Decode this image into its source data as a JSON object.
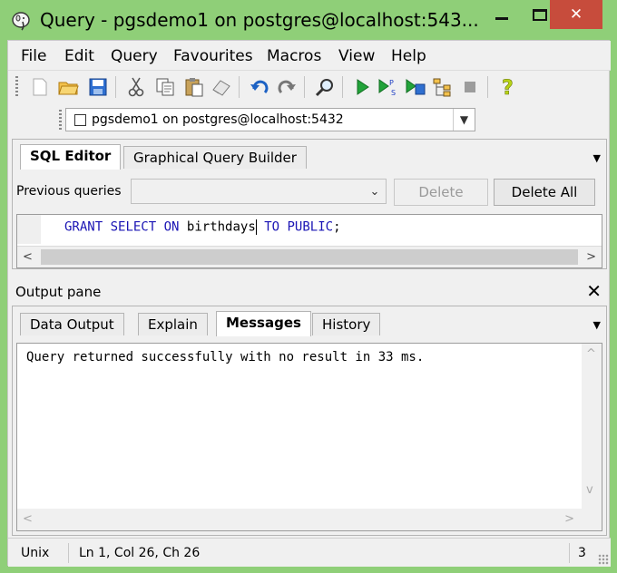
{
  "window": {
    "title": "Query - pgsdemo1 on postgres@localhost:543...",
    "close_glyph": "✕"
  },
  "menu": {
    "items": [
      "File",
      "Edit",
      "Query",
      "Favourites",
      "Macros",
      "View",
      "Help"
    ]
  },
  "toolbar": {
    "icons": [
      "new-icon",
      "open-icon",
      "save-icon",
      "cut-icon",
      "copy-icon",
      "paste-icon",
      "clear-icon",
      "undo-icon",
      "redo-icon",
      "find-icon",
      "execute-icon",
      "execute-pgscript-icon",
      "execute-to-file-icon",
      "explain-icon",
      "cancel-icon",
      "help-icon"
    ]
  },
  "connection": {
    "selected": "pgsdemo1 on postgres@localhost:5432"
  },
  "sql_panel": {
    "tabs": [
      "SQL Editor",
      "Graphical Query Builder"
    ],
    "active_tab": "SQL Editor",
    "previous_queries_label": "Previous queries",
    "previous_queries_value": "",
    "delete_label": "Delete",
    "delete_all_label": "Delete All",
    "sql": {
      "kw1": "GRANT",
      "kw2": "SELECT",
      "kw3": "ON",
      "table_before_caret": "birthdays",
      "kw4": "TO",
      "kw5": "PUBLIC",
      "tail": ";"
    }
  },
  "output": {
    "title": "Output pane",
    "tabs": [
      "Data Output",
      "Explain",
      "Messages",
      "History"
    ],
    "active_tab": "Messages",
    "message": "Query returned successfully with no result in 33 ms."
  },
  "status": {
    "line_ending": "Unix",
    "position": "Ln 1, Col 26, Ch 26",
    "right": "3"
  },
  "colors": {
    "window_frame": "#8fcf78",
    "close_button": "#c74c3c",
    "sql_keyword": "#1a14b4"
  }
}
